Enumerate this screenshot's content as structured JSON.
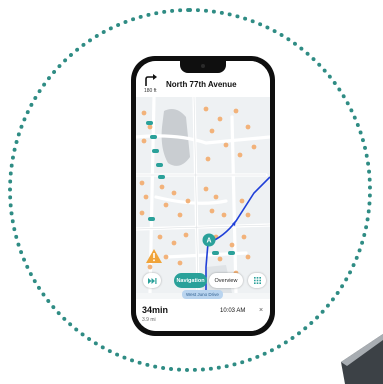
{
  "header": {
    "street": "North 77th Avenue",
    "distance": "180 ft",
    "turn_icon": "turn-right-arrow-icon"
  },
  "map": {
    "route_color": "#1f3fd8",
    "building_color": "#f2b27a",
    "lot_color": "#2aa19a",
    "road_label": "West Juno Drive",
    "marker_letter": "A"
  },
  "controls": {
    "skip_icon": "skip-icon",
    "navigation_label": "Navigation",
    "overview_label": "Overview",
    "grid_icon": "grid-icon"
  },
  "footer": {
    "eta": "34min",
    "miles": "3.9 mi",
    "arrival": "10:03 AM",
    "close_glyph": "×"
  },
  "colors": {
    "accent": "#2aa19a",
    "ring": "#2f8c84"
  }
}
